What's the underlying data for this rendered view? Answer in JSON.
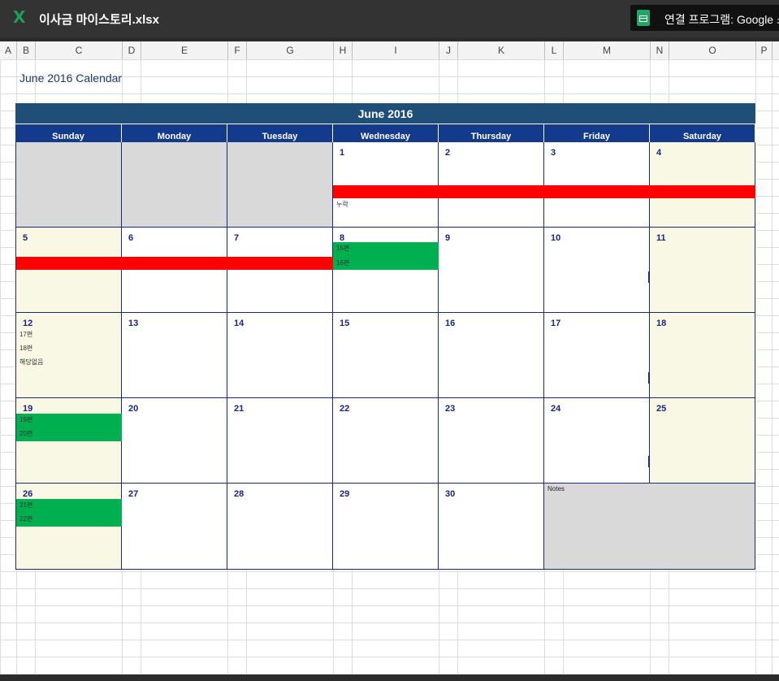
{
  "window": {
    "app_icon": "X",
    "file_title": "이사금 마이스토리.xlsx",
    "open_with_label": "연결 프로그램: Google 스"
  },
  "columns": [
    "A",
    "B",
    "C",
    "D",
    "E",
    "F",
    "G",
    "H",
    "I",
    "J",
    "K",
    "L",
    "M",
    "N",
    "O",
    "P"
  ],
  "sheet": {
    "title": "June 2016 Calendar"
  },
  "calendar": {
    "month_title": "June 2016",
    "days_of_week": [
      "Sunday",
      "Monday",
      "Tuesday",
      "Wednesday",
      "Thursday",
      "Friday",
      "Saturday"
    ],
    "week1": [
      "",
      "",
      "",
      "1",
      "2",
      "3",
      "4"
    ],
    "week2": [
      "5",
      "6",
      "7",
      "8",
      "9",
      "10",
      "11"
    ],
    "week3": [
      "12",
      "13",
      "14",
      "15",
      "16",
      "17",
      "18"
    ],
    "week4": [
      "19",
      "20",
      "21",
      "22",
      "23",
      "24",
      "25"
    ],
    "week5": [
      "26",
      "27",
      "28",
      "29",
      "30"
    ],
    "notes_label": "Notes",
    "entries": {
      "d1": "누락",
      "d8a": "15편",
      "d8b": "16편",
      "d12a": "17편",
      "d12b": "18편",
      "d12c": "해당없음",
      "d19a": "19편",
      "d19b": "20편",
      "d26a": "21편",
      "d26b": "22편"
    }
  },
  "colors": {
    "header_bg": "#1f4e79",
    "dow_bg": "#143a8c",
    "weekend_bg": "#f8f8e4",
    "blank_bg": "#d9d9d9",
    "red_bar": "#ff0000",
    "green_bar": "#00b050"
  }
}
